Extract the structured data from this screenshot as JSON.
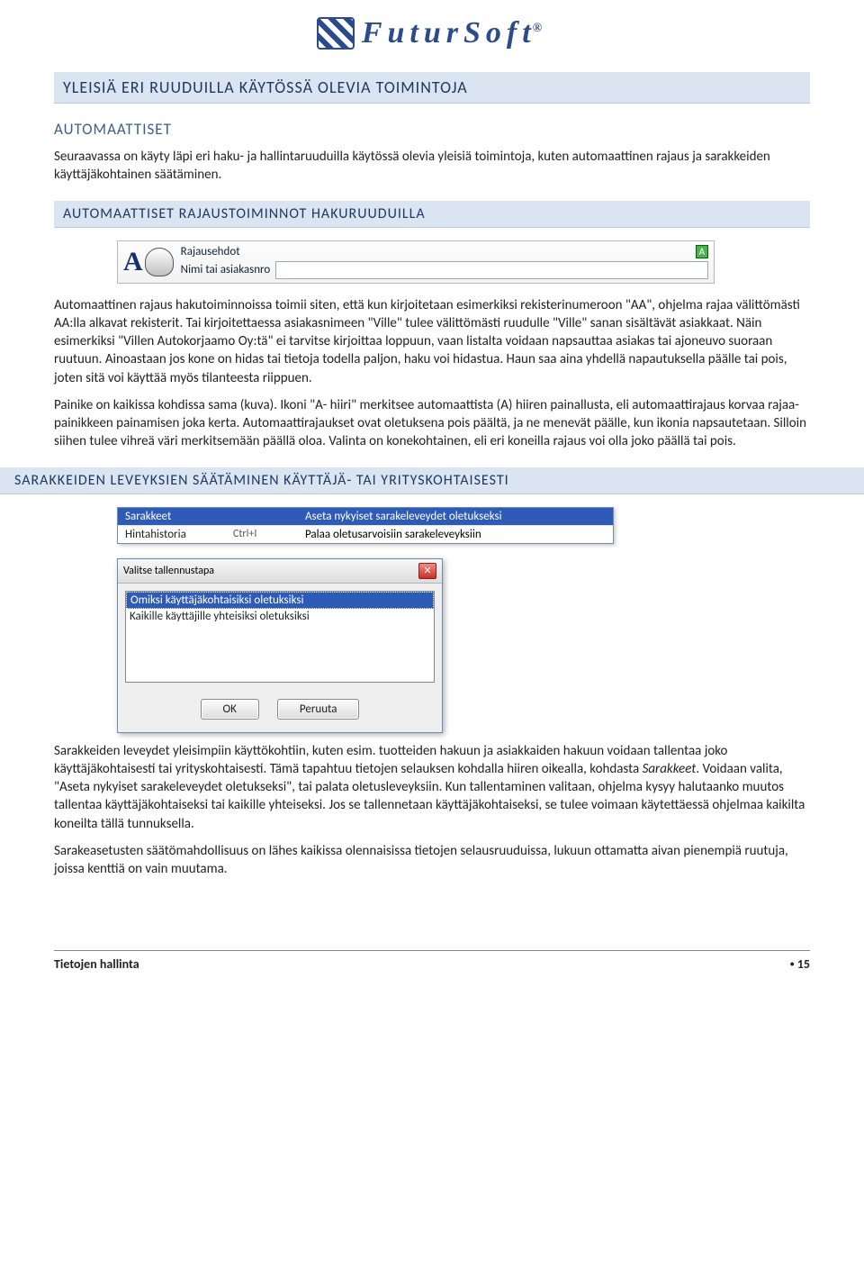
{
  "brand": {
    "name": "FuturSoft",
    "reg": "®"
  },
  "h1": "YLEISIÄ ERI RUUDUILLA KÄYTÖSSÄ OLEVIA TOIMINTOJA",
  "sec1": {
    "title": "AUTOMAATTISET",
    "p1": "Seuraavassa on käyty läpi eri haku- ja hallintaruuduilla käytössä olevia yleisiä toimintoja, kuten automaattinen rajaus ja sarakkeiden käyttäjäkohtainen säätäminen."
  },
  "sec2": {
    "title": "AUTOMAATTISET RAJAUSTOIMINNOT HAKURUUDUILLA",
    "ui": {
      "label1": "Rajausehdot",
      "label2": "Nimi tai asiakasnro",
      "badge": "A"
    },
    "p1": "Automaattinen rajaus hakutoiminnoissa toimii siten, että kun kirjoitetaan esimerkiksi rekisterinumeroon \"AA\", ohjelma rajaa välittömästi AA:lla alkavat rekisterit. Tai kirjoitettaessa asiakasnimeen \"Ville\" tulee välittömästi ruudulle \"Ville\" sanan sisältävät asiakkaat. Näin esimerkiksi \"Villen Autokorjaamo Oy:tä\" ei tarvitse kirjoittaa loppuun, vaan listalta voidaan napsauttaa asiakas tai ajoneuvo suoraan ruutuun. Ainoastaan jos kone on hidas tai tietoja todella paljon, haku voi hidastua. Haun saa aina yhdellä napautuksella päälle tai pois, joten sitä voi käyttää myös tilanteesta riippuen.",
    "p2": "Painike on kaikissa kohdissa sama (kuva). Ikoni \"A- hiiri\" merkitsee automaattista (A) hiiren painallusta, eli automaattirajaus korvaa rajaa- painikkeen painamisen joka kerta. Automaattirajaukset ovat oletuksena pois päältä, ja ne menevät päälle, kun ikonia napsautetaan. Silloin siihen tulee vihreä väri merkitsemään päällä oloa. Valinta on konekohtainen, eli eri koneilla rajaus voi olla joko päällä tai pois."
  },
  "sec3": {
    "title": "SARAKKEIDEN LEVEYKSIEN SÄÄTÄMINEN KÄYTTÄJÄ- TAI YRITYSKOHTAISESTI",
    "menu": {
      "row1_col1": "Sarakkeet",
      "row1_col3": "Aseta nykyiset sarakeleveydet oletukseksi",
      "row2_col1": "Hintahistoria",
      "row2_col2": "Ctrl+I",
      "row2_col3": "Palaa oletusarvoisiin sarakeleveyksiin"
    },
    "dialog": {
      "title": "Valitse tallennustapa",
      "opt1": "Omiksi käyttäjäkohtaisiksi oletuksiksi",
      "opt2": "Kaikille käyttäjille yhteisiksi oletuksiksi",
      "ok": "OK",
      "cancel": "Peruuta"
    },
    "p1a": "Sarakkeiden leveydet yleisimpiin käyttökohtiin, kuten esim. tuotteiden hakuun ja asiakkaiden hakuun voidaan tallentaa joko käyttäjäkohtaisesti tai yrityskohtaisesti. Tämä tapahtuu tietojen selauksen kohdalla hiiren oikealla, kohdasta ",
    "p1_italic": "Sarakkeet",
    "p1b": ". Voidaan valita, \"Aseta nykyiset sarakeleveydet oletukseksi\", tai palata oletusleveyksiin. Kun tallentaminen valitaan, ohjelma kysyy halutaanko muutos tallentaa käyttäjäkohtaiseksi tai kaikille yhteiseksi. Jos se tallennetaan käyttäjäkohtaiseksi, se tulee voimaan käytettäessä ohjelmaa kaikilta koneilta tällä tunnuksella.",
    "p2": "Sarakeasetusten säätömahdollisuus on lähes kaikissa olennaisissa tietojen selausruuduissa, lukuun ottamatta aivan pienempiä ruutuja, joissa kenttiä on vain muutama."
  },
  "footer": {
    "title": "Tietojen hallinta",
    "bullet": "•",
    "page": "15"
  }
}
